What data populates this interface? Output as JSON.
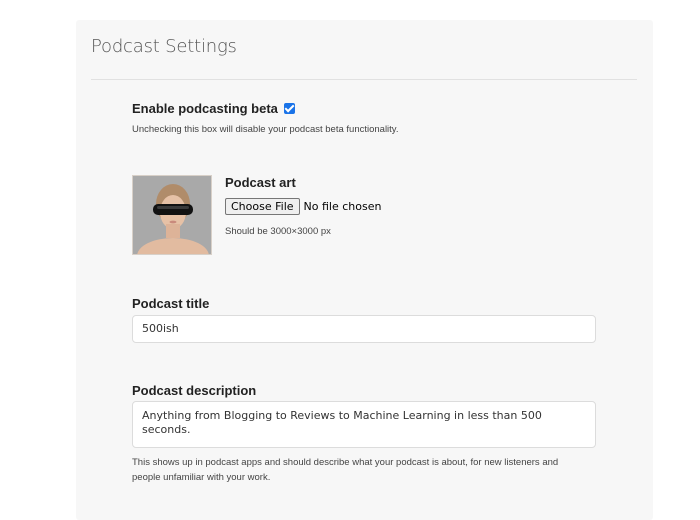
{
  "panel": {
    "title": "Podcast Settings"
  },
  "beta": {
    "label": "Enable podcasting beta",
    "checked": true,
    "help": "Unchecking this box will disable your podcast beta functionality."
  },
  "art": {
    "label": "Podcast art",
    "choose_button": "Choose File",
    "file_status": "No file chosen",
    "help": "Should be 3000×3000 px"
  },
  "title_field": {
    "label": "Podcast title",
    "value": "500ish"
  },
  "description_field": {
    "label": "Podcast description",
    "value": "Anything from Blogging to Reviews to Machine Learning in less than 500 seconds.",
    "help_line1": "This shows up in podcast apps and should describe what your podcast is about, for new listeners and",
    "help_line2": "people unfamiliar with your work."
  }
}
